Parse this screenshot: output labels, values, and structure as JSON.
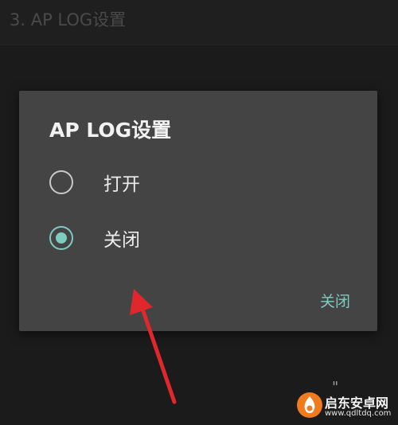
{
  "background": {
    "title": "3. AP LOG设置",
    "hint": "\""
  },
  "dialog": {
    "title": "AP LOG设置",
    "options": [
      {
        "label": "打开",
        "selected": false
      },
      {
        "label": "关闭",
        "selected": true
      }
    ],
    "button_label": "关闭"
  },
  "watermark": {
    "name": "启东安卓网",
    "url": "www.qdltdq.com"
  },
  "colors": {
    "accent": "#7ecbc0",
    "dialog_bg": "#444444",
    "annotation_arrow": "#e0282c"
  }
}
